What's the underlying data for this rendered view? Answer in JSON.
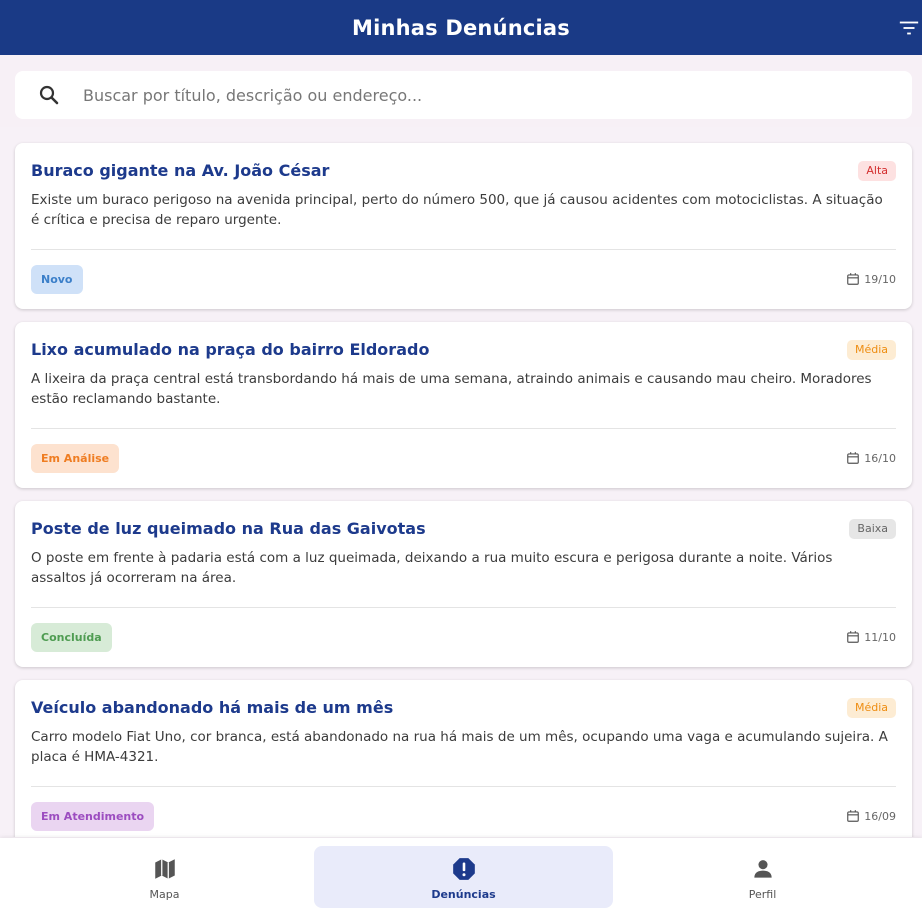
{
  "header": {
    "title": "Minhas Denúncias",
    "filter_icon": "filter-icon"
  },
  "search": {
    "placeholder": "Buscar por título, descrição ou endereço...",
    "value": "",
    "icon": "search-icon"
  },
  "reports": [
    {
      "title": "Buraco gigante na Av. João César",
      "priority": "Alta",
      "description": "Existe um buraco perigoso na avenida principal, perto do número 500, que já causou acidentes com motociclistas. A situação é crítica e precisa de reparo urgente.",
      "status": "Novo",
      "date": "19/10"
    },
    {
      "title": "Lixo acumulado na praça do bairro Eldorado",
      "priority": "Média",
      "description": "A lixeira da praça central está transbordando há mais de uma semana, atraindo animais e causando mau cheiro. Moradores estão reclamando bastante.",
      "status": "Em Análise",
      "date": "16/10"
    },
    {
      "title": "Poste de luz queimado na Rua das Gaivotas",
      "priority": "Baixa",
      "description": "O poste em frente à padaria está com a luz queimada, deixando a rua muito escura e perigosa durante a noite. Vários assaltos já ocorreram na área.",
      "status": "Concluída",
      "date": "11/10"
    },
    {
      "title": "Veículo abandonado há mais de um mês",
      "priority": "Média",
      "description": "Carro modelo Fiat Uno, cor branca, está abandonado na rua há mais de um mês, ocupando uma vaga e acumulando sujeira. A placa é HMA-4321.",
      "status": "Em Atendimento",
      "date": "16/09"
    }
  ],
  "colors": {
    "primary": "#1a3a86",
    "title": "#1d3a8c",
    "priority_alta": "#d32f2f",
    "priority_media": "#ee8d12",
    "priority_baixa": "#666666",
    "status_novo": "#3b7fc9",
    "status_analise": "#ef7d22",
    "status_concluida": "#4f9c52",
    "status_atendimento": "#9c4dc0"
  },
  "nav": {
    "items": [
      {
        "label": "Mapa",
        "icon": "map-icon"
      },
      {
        "label": "Denúncias",
        "icon": "alert-icon",
        "active": true
      },
      {
        "label": "Perfil",
        "icon": "person-icon"
      }
    ]
  }
}
